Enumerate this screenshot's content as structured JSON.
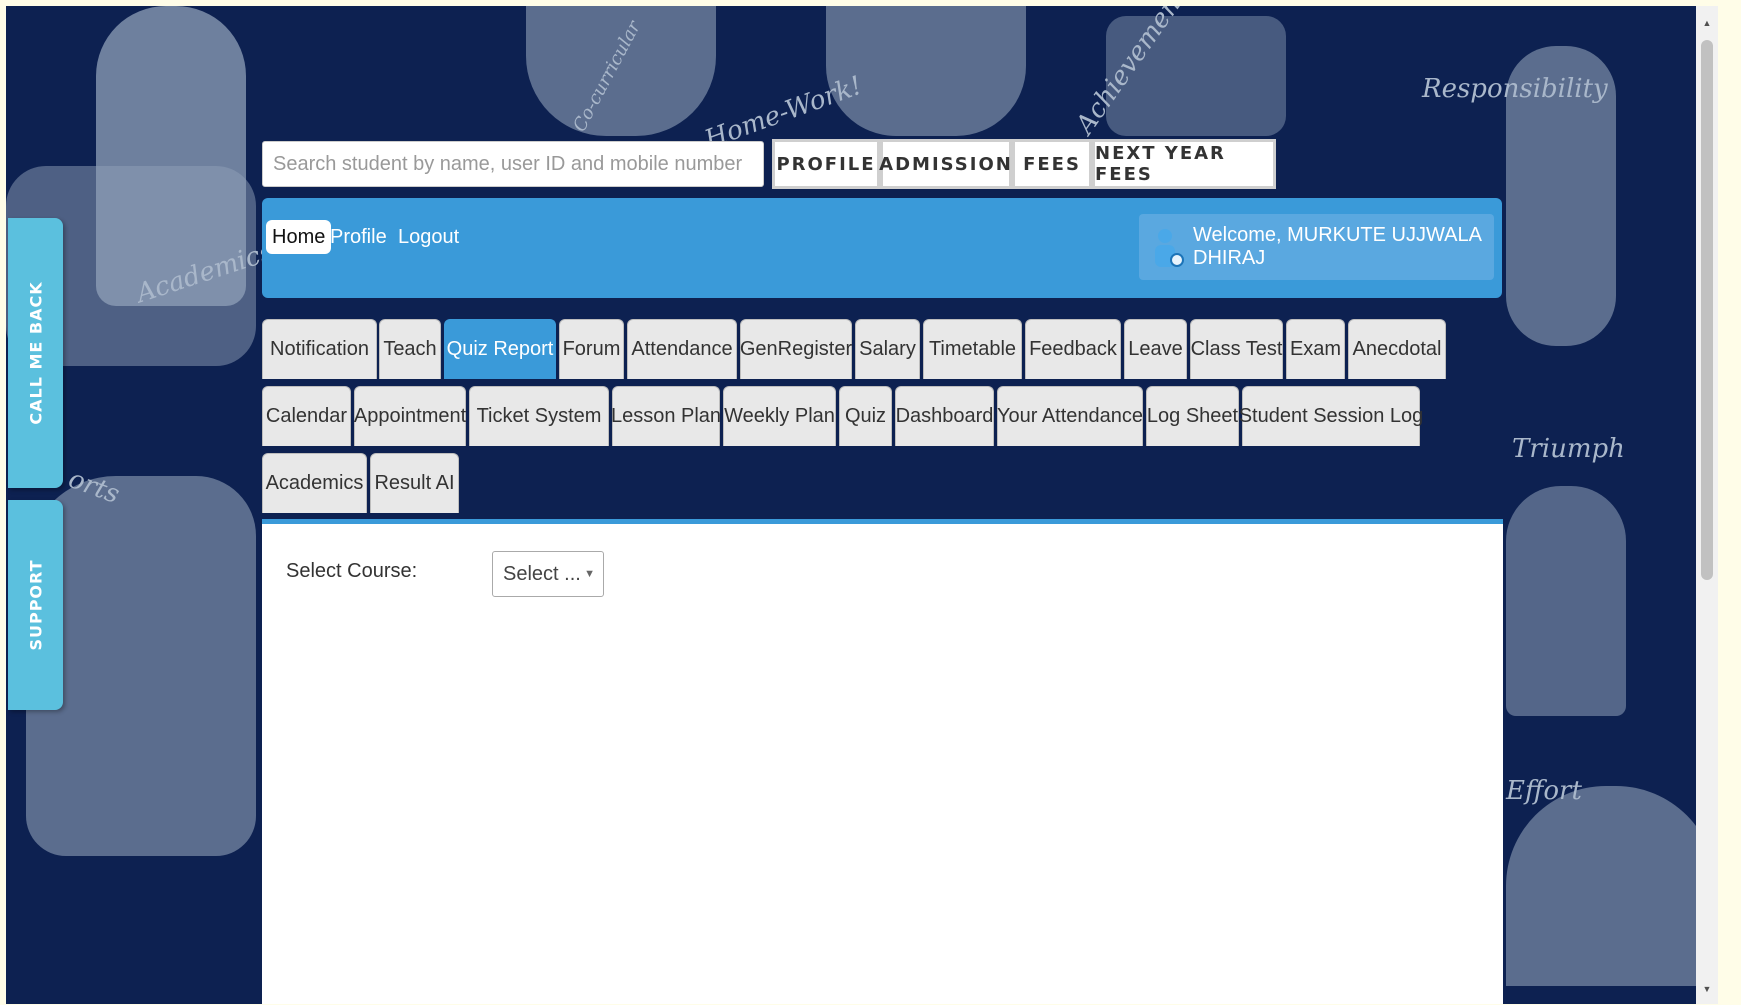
{
  "search": {
    "placeholder": "Search student by name, user ID and mobile number"
  },
  "top_buttons": [
    "PROFILE",
    "ADMISSION",
    "FEES",
    "NEXT YEAR FEES"
  ],
  "side_tabs": {
    "call_me_back": "CALL ME BACK",
    "support": "SUPPORT"
  },
  "header": {
    "nav": [
      "Home",
      "Profile",
      "Logout"
    ],
    "active_nav": "Home",
    "welcome": "Welcome, MURKUTE UJJWALA DHIRAJ"
  },
  "tabs": {
    "row1": [
      "Notification",
      "Teach",
      "Quiz Report",
      "Forum",
      "Attendance",
      "GenRegister",
      "Salary",
      "Timetable",
      "Feedback",
      "Leave",
      "Class Test",
      "Exam",
      "Anecdotal"
    ],
    "row2": [
      "Calendar",
      "Appointment",
      "Ticket System",
      "Lesson Plan",
      "Weekly Plan",
      "Quiz",
      "Dashboard",
      "Your Attendance",
      "Log Sheet",
      "Student Session Log"
    ],
    "row3": [
      "Academics",
      "Result AI"
    ],
    "active": "Quiz Report"
  },
  "content": {
    "course_label": "Select Course:",
    "course_select_value": "Select ..."
  },
  "background_words": [
    "Academics",
    "Home-Work!",
    "Achievement",
    "Responsibility",
    "Triumph",
    "Effort",
    "orts",
    "Co-curricular"
  ],
  "colors": {
    "page_bg": "#0d2151",
    "accent": "#3a9ad9",
    "side_tab": "#5bc0de"
  }
}
